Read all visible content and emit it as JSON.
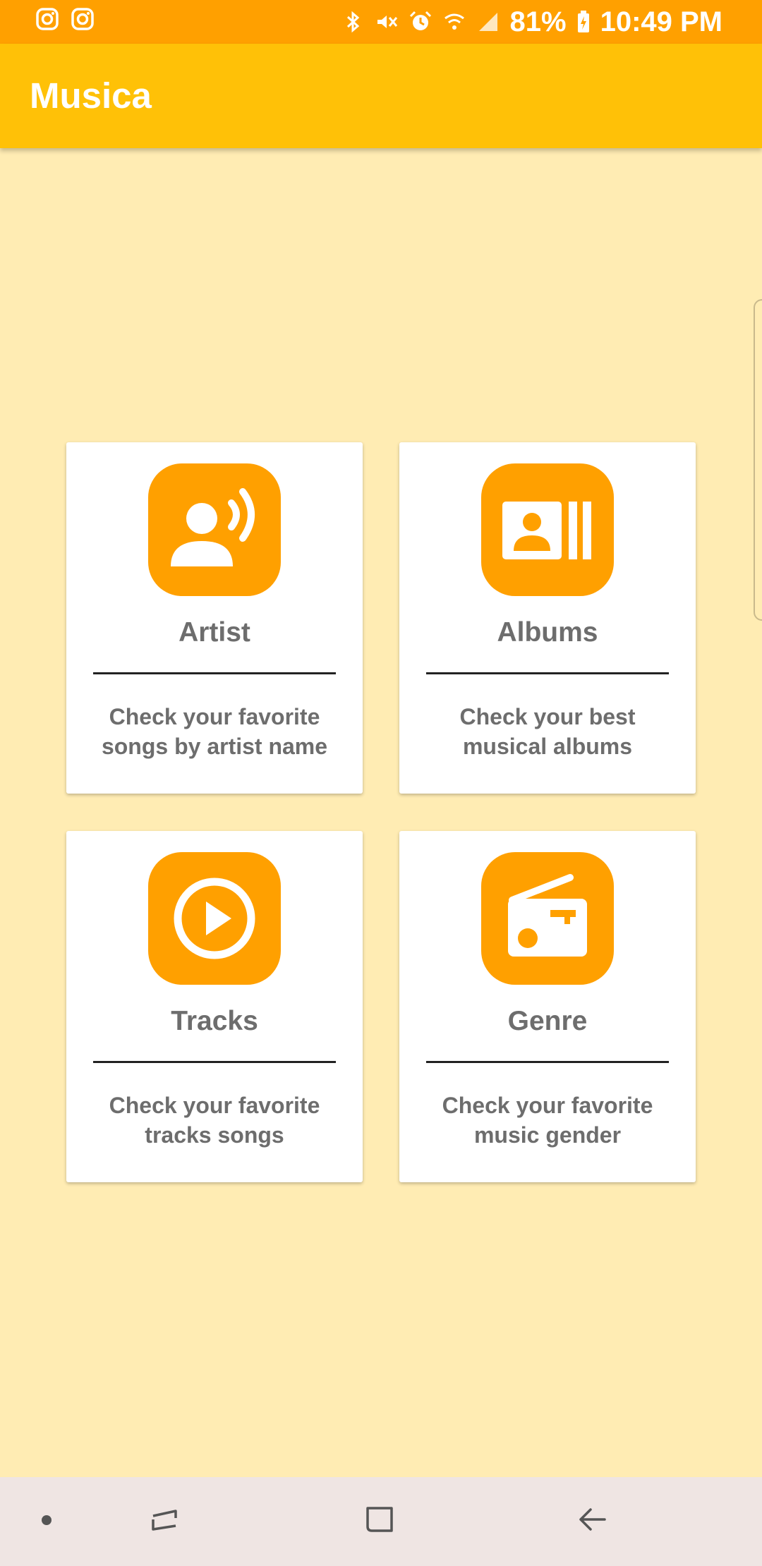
{
  "status_bar": {
    "battery_percent": "81%",
    "time": "10:49 PM",
    "left_icons": [
      "instagram-icon",
      "instagram-icon"
    ],
    "right_icons": [
      "bluetooth-icon",
      "vibrate-icon",
      "alarm-icon",
      "wifi-icon",
      "signal-icon",
      "battery-charging-icon"
    ]
  },
  "app_bar": {
    "title": "Musica"
  },
  "colors": {
    "status_bar": "#FFA000",
    "app_bar": "#FFC107",
    "background": "#FFECB3",
    "icon_tile": "#FFA000",
    "card_text": "#6D6D6D",
    "nav_bar": "#EFE5E3"
  },
  "cards": [
    {
      "icon": "artist-icon",
      "title": "Artist",
      "description_lines": [
        "Check your favorite",
        "songs by artist name"
      ]
    },
    {
      "icon": "albums-icon",
      "title": "Albums",
      "description_lines": [
        "Check your best",
        "musical albums"
      ]
    },
    {
      "icon": "play-circle-icon",
      "title": "Tracks",
      "description_lines": [
        "Check your favorite",
        "tracks songs"
      ]
    },
    {
      "icon": "radio-icon",
      "title": "Genre",
      "description_lines": [
        "Check your favorite",
        "music gender"
      ]
    }
  ],
  "nav_bar": {
    "buttons": [
      "dot-icon",
      "recent-apps-icon",
      "home-icon",
      "back-icon"
    ]
  }
}
